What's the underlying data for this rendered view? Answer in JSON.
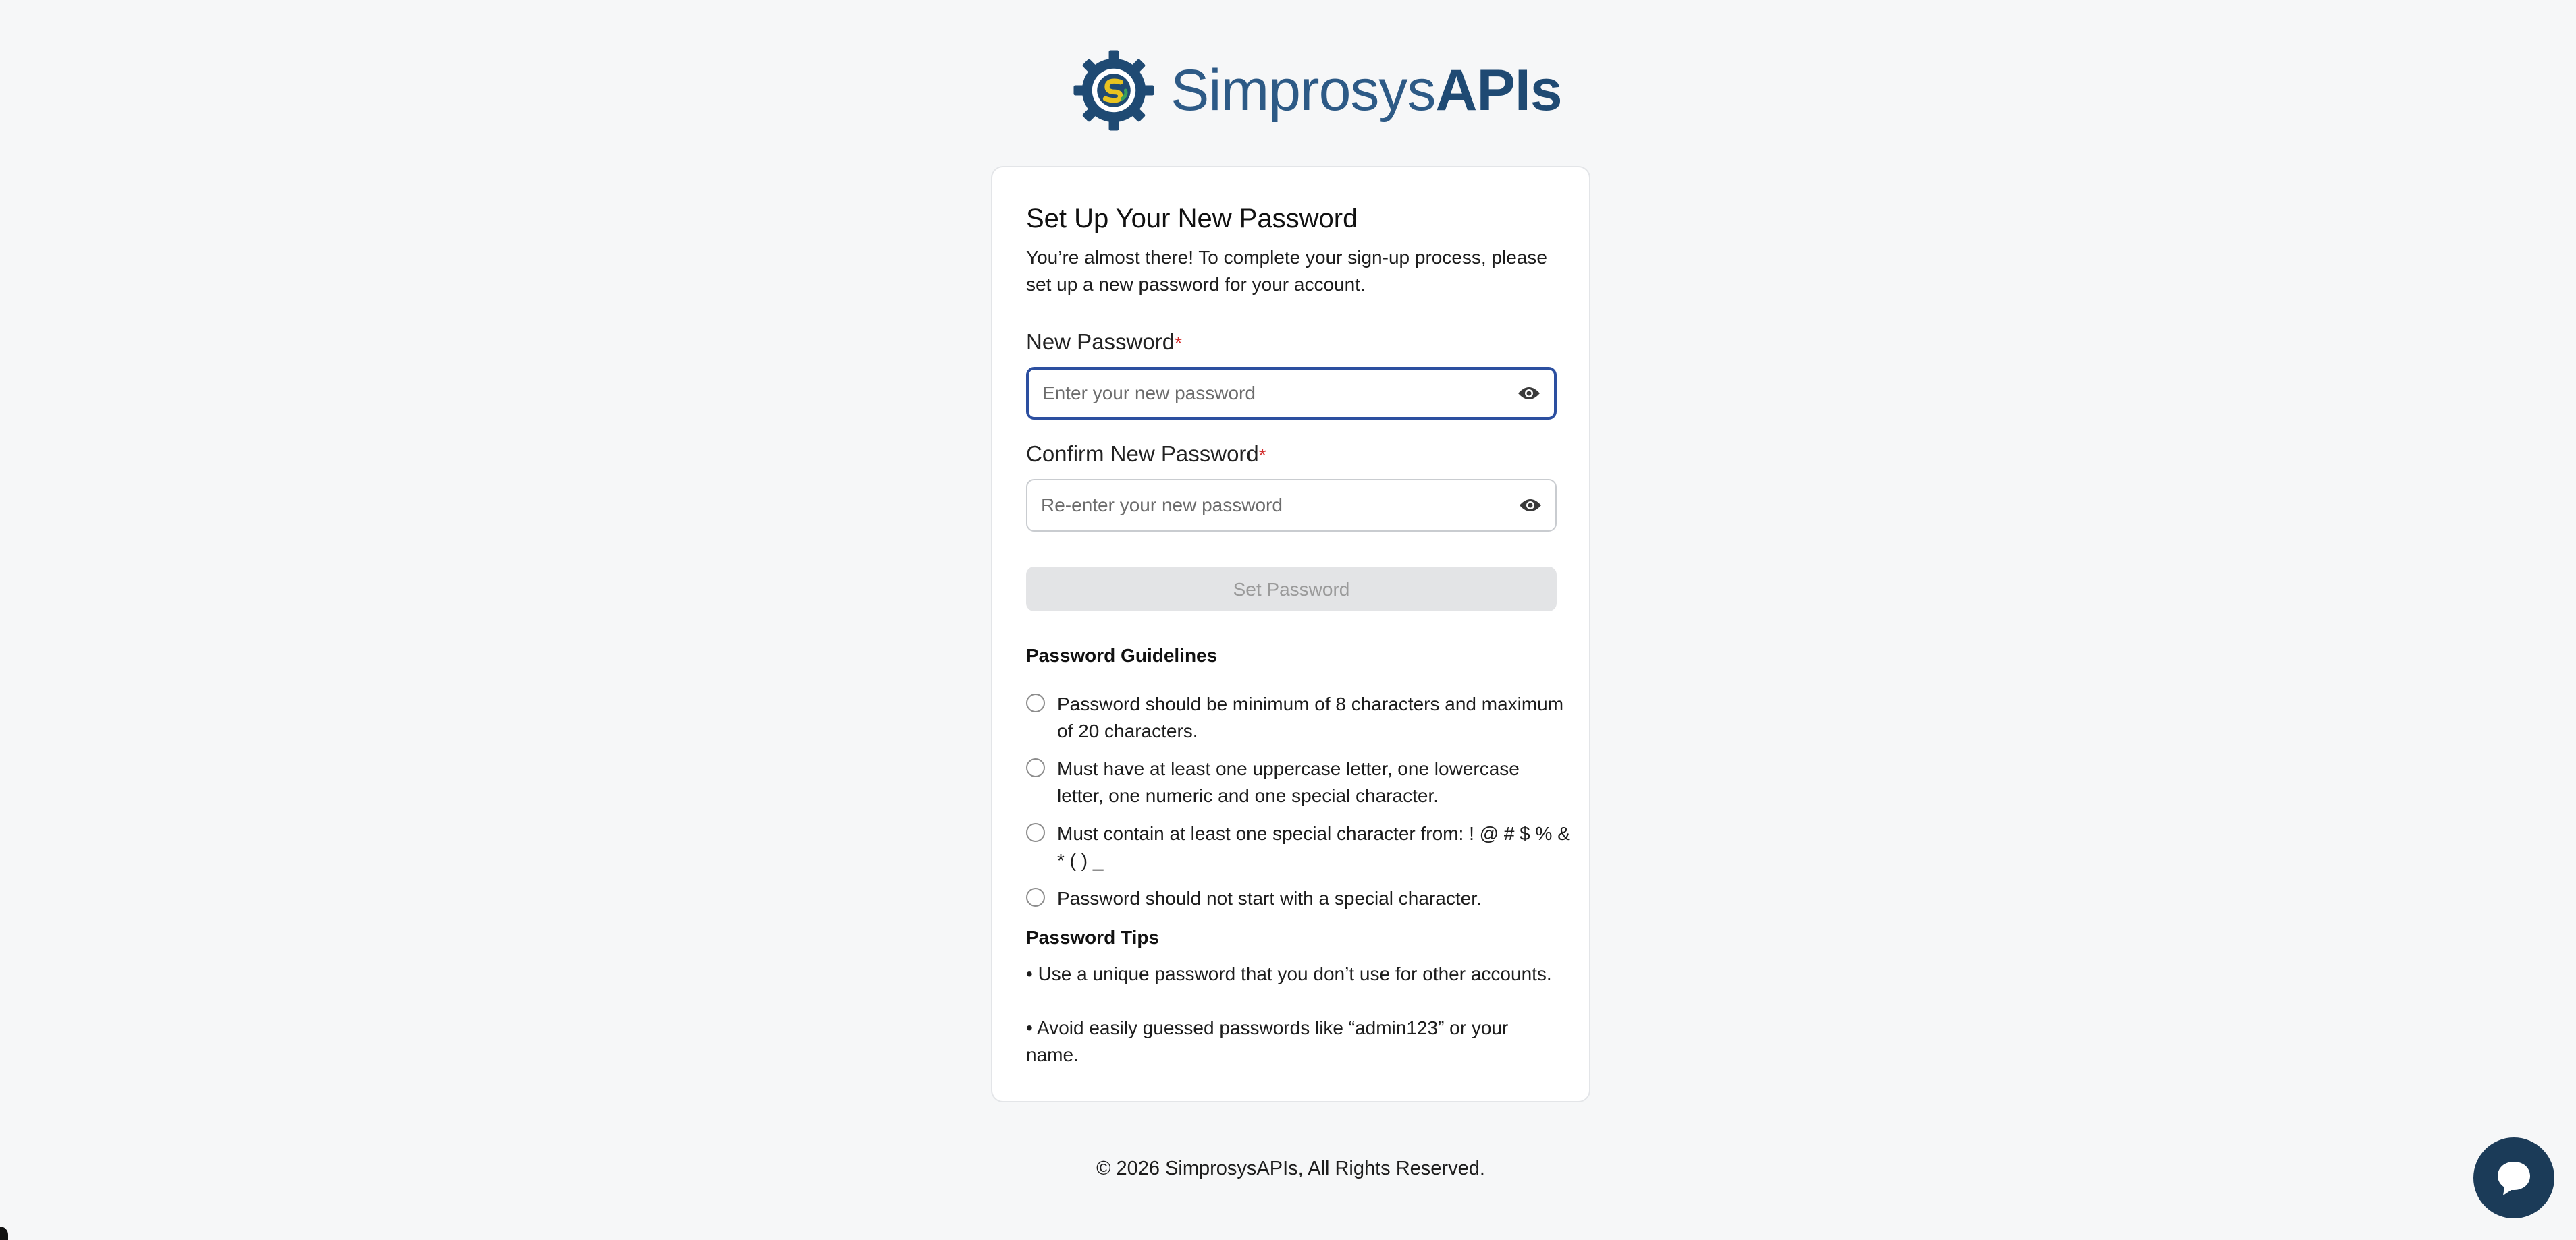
{
  "brand": {
    "name_regular": "Simprosys",
    "name_bold": "APIs",
    "colors": {
      "primary": "#2d5a86",
      "accent_yellow": "#e8c320",
      "accent_green": "#3aa05a"
    }
  },
  "card": {
    "title": "Set Up Your New Password",
    "subtitle": "You’re almost there! To complete your sign-up process, please set up a new password for your account."
  },
  "fields": {
    "new_password": {
      "label": "New Password",
      "required_mark": "*",
      "placeholder": "Enter your new password",
      "value": "",
      "icon": "eye-icon"
    },
    "confirm_password": {
      "label": "Confirm New Password",
      "required_mark": "*",
      "placeholder": "Re-enter your new password",
      "value": "",
      "icon": "eye-icon"
    }
  },
  "submit": {
    "label": "Set Password",
    "disabled": true
  },
  "guidelines": {
    "title": "Password Guidelines",
    "items": [
      "Password should be minimum of 8 characters and maximum of 20 characters.",
      "Must have at least one uppercase letter, one lowercase letter, one numeric and one special character.",
      "Must contain at least one special character from: ! @ # $ % & * ( ) _",
      "Password should not start with a special character."
    ]
  },
  "tips": {
    "title": "Password Tips",
    "items": [
      "• Use a unique password that you don’t use for other accounts.",
      "• Avoid easily guessed passwords like “admin123” or your name."
    ]
  },
  "footer": {
    "text": "© 2026 SimprosysAPIs, All Rights Reserved."
  },
  "chat_widget": {
    "icon": "chat-bubble-icon",
    "color": "#1b3b58"
  }
}
